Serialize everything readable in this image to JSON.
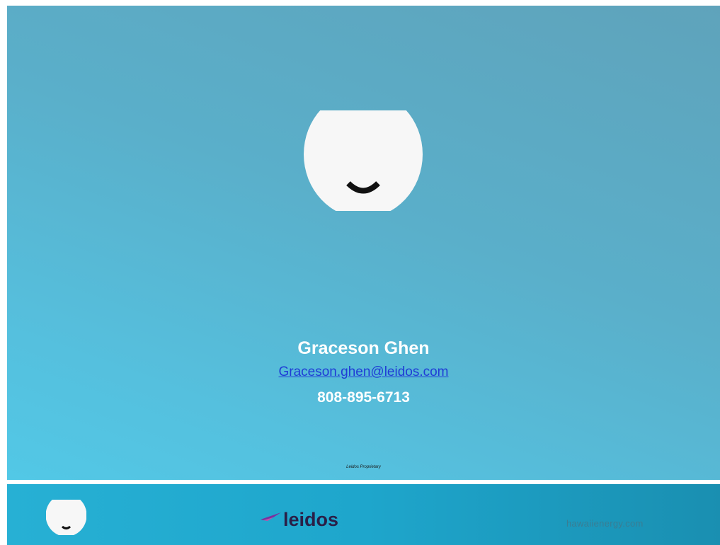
{
  "slide": {
    "contact": {
      "name": "Graceson Ghen",
      "email": "Graceson.ghen@leidos.com",
      "phone": "808-895-6713"
    },
    "proprietary_note": "Leidos Proprietary",
    "logo_icon": "smile-circle-icon"
  },
  "footer": {
    "logo_icon": "smile-circle-icon",
    "brand_icon": "leidos-swoosh-icon",
    "brand": "leidos",
    "website": "hawaiienergy.com"
  },
  "colors": {
    "slide_gradient_start": "#5fa3bb",
    "slide_gradient_end": "#52c8e6",
    "footer_bar": "#1ea6cc",
    "email_link": "#1f3cd6",
    "brand_text": "#2a1f47",
    "brand_swoosh": "#7b2f9e"
  }
}
